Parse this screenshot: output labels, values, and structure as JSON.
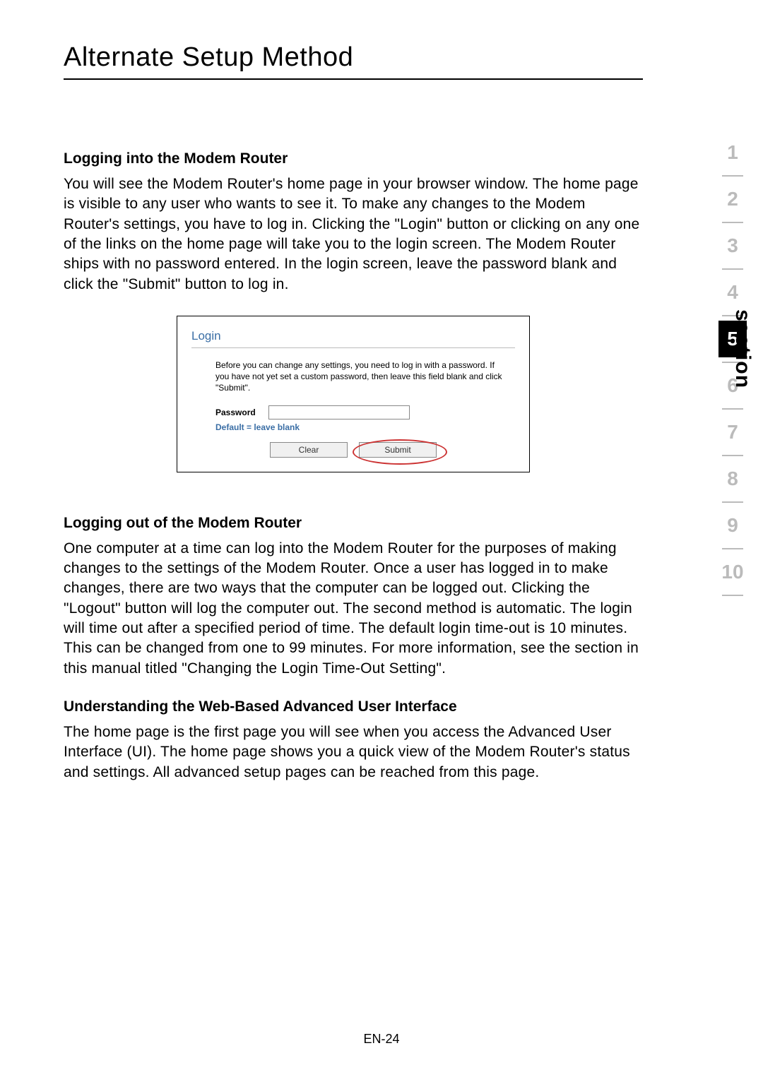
{
  "title": "Alternate Setup Method",
  "sections": {
    "login_heading": "Logging into the Modem Router",
    "login_body": "You will see the Modem Router's home page in your browser window. The home page is visible to any user who wants to see it. To make any changes to the Modem Router's settings, you have to log in. Clicking the \"Login\" button or clicking on any one of the links on the home page will take you to the login screen. The Modem Router ships with no password entered. In the login screen, leave the password blank and click the \"Submit\" button to log in.",
    "logout_heading": "Logging out of the Modem Router",
    "logout_body": "One computer at a time can log into the Modem Router for the purposes of making changes to the settings of the Modem Router. Once a user has logged in to make changes, there are two ways that the computer can be logged out. Clicking the \"Logout\" button will log the computer out. The second method is automatic. The login will time out after a specified period of time. The default login time-out is 10 minutes. This can be changed from one to 99 minutes. For more information, see the section in this manual titled \"Changing the Login Time-Out Setting\".",
    "ui_heading": "Understanding the Web-Based Advanced User Interface",
    "ui_body": "The home page is the first page you will see when you access the Advanced User Interface (UI). The home page shows you a quick view of the Modem Router's status and settings. All advanced setup pages can be reached from this page."
  },
  "login_panel": {
    "title": "Login",
    "desc": "Before you can change any settings, you need to log in with a password. If you have not yet set a custom password, then leave this field blank and click \"Submit\".",
    "pw_label": "Password",
    "hint": "Default = leave blank",
    "clear": "Clear",
    "submit": "Submit"
  },
  "side": {
    "label": "section",
    "tabs": [
      "1",
      "2",
      "3",
      "4",
      "5",
      "6",
      "7",
      "8",
      "9",
      "10"
    ],
    "active_index": 4
  },
  "page_number": "EN-24"
}
